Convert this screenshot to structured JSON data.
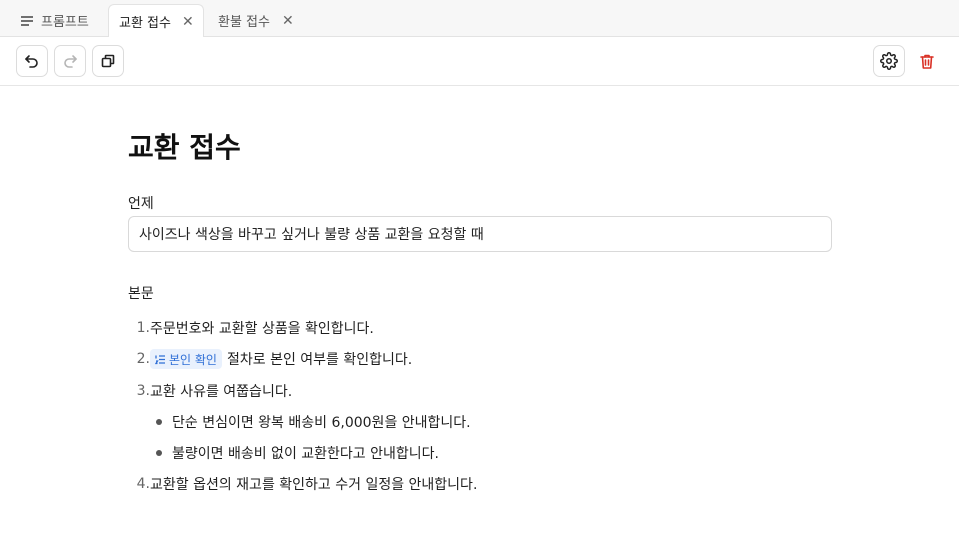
{
  "tabs": [
    {
      "label": "프롬프트"
    },
    {
      "label": "교환 접수",
      "close": "✕"
    },
    {
      "label": "환불 접수",
      "close": "✕"
    }
  ],
  "page": {
    "title": "교환 접수",
    "subject_label": "언제",
    "subject_value": "사이즈나 색상을 바꾸고 싶거나 불량 상품 교환을 요청할 때",
    "body_label": "본문",
    "steps": [
      {
        "num": "1.",
        "text": "주문번호와 교환할 상품을 확인합니다."
      },
      {
        "num": "2.",
        "chip": "본인 확인",
        "text": "절차로 본인 여부를 확인합니다."
      },
      {
        "num": "3.",
        "text": "교환 사유를 여쭙습니다."
      },
      {
        "num": "4.",
        "text": "교환할 옵션의 재고를 확인하고 수거 일정을 안내합니다."
      }
    ],
    "sub_bullets": [
      "단순 변심이면 왕복 배송비 6,000원을 안내합니다.",
      "불량이면 배송비 없이 교환한다고 안내합니다."
    ]
  },
  "colors": {
    "delete_icon": "#d93025",
    "chip_bg": "#e9f1fd",
    "chip_text": "#2f6fd6"
  }
}
